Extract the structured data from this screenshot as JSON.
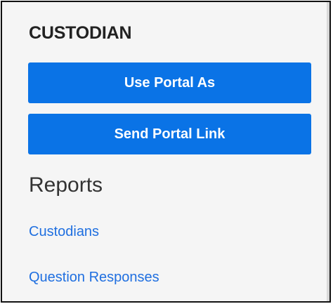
{
  "panel": {
    "title": "CUSTODIAN",
    "buttons": {
      "use_portal_as": "Use Portal As",
      "send_portal_link": "Send Portal Link"
    },
    "reports": {
      "heading": "Reports",
      "links": [
        "Custodians",
        "Question Responses"
      ]
    }
  },
  "colors": {
    "button_bg": "#0a73e6",
    "link": "#1f6fe0",
    "panel_bg": "#f5f5f5",
    "border": "#111111"
  }
}
